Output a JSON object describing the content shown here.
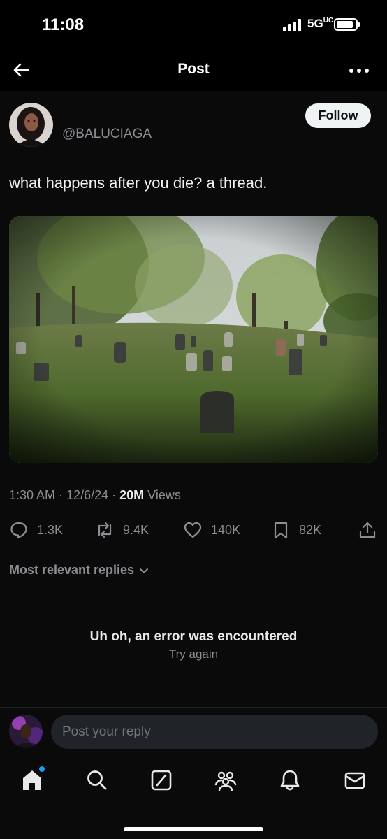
{
  "status_bar": {
    "time": "11:08",
    "network": "5G",
    "network_badge": "UC",
    "battery_level": 0.9
  },
  "header": {
    "title": "Post"
  },
  "post": {
    "handle": "@BALUCIAGA",
    "follow_label": "Follow",
    "text": "what happens after you die? a thread.",
    "time": "1:30 AM",
    "date": "12/6/24",
    "views": "20M",
    "views_label": "Views",
    "replies": "1.3K",
    "reposts": "9.4K",
    "likes": "140K",
    "bookmarks": "82K"
  },
  "replies_section": {
    "sort_label": "Most relevant replies",
    "error_title": "Uh oh, an error was encountered",
    "retry_label": "Try again"
  },
  "composer": {
    "placeholder": "Post your reply"
  },
  "tabs": {
    "icons": [
      "home-icon",
      "search-icon",
      "grok-icon",
      "communities-icon",
      "notifications-icon",
      "messages-icon"
    ],
    "home_badge_color": "#1d9bf0"
  }
}
